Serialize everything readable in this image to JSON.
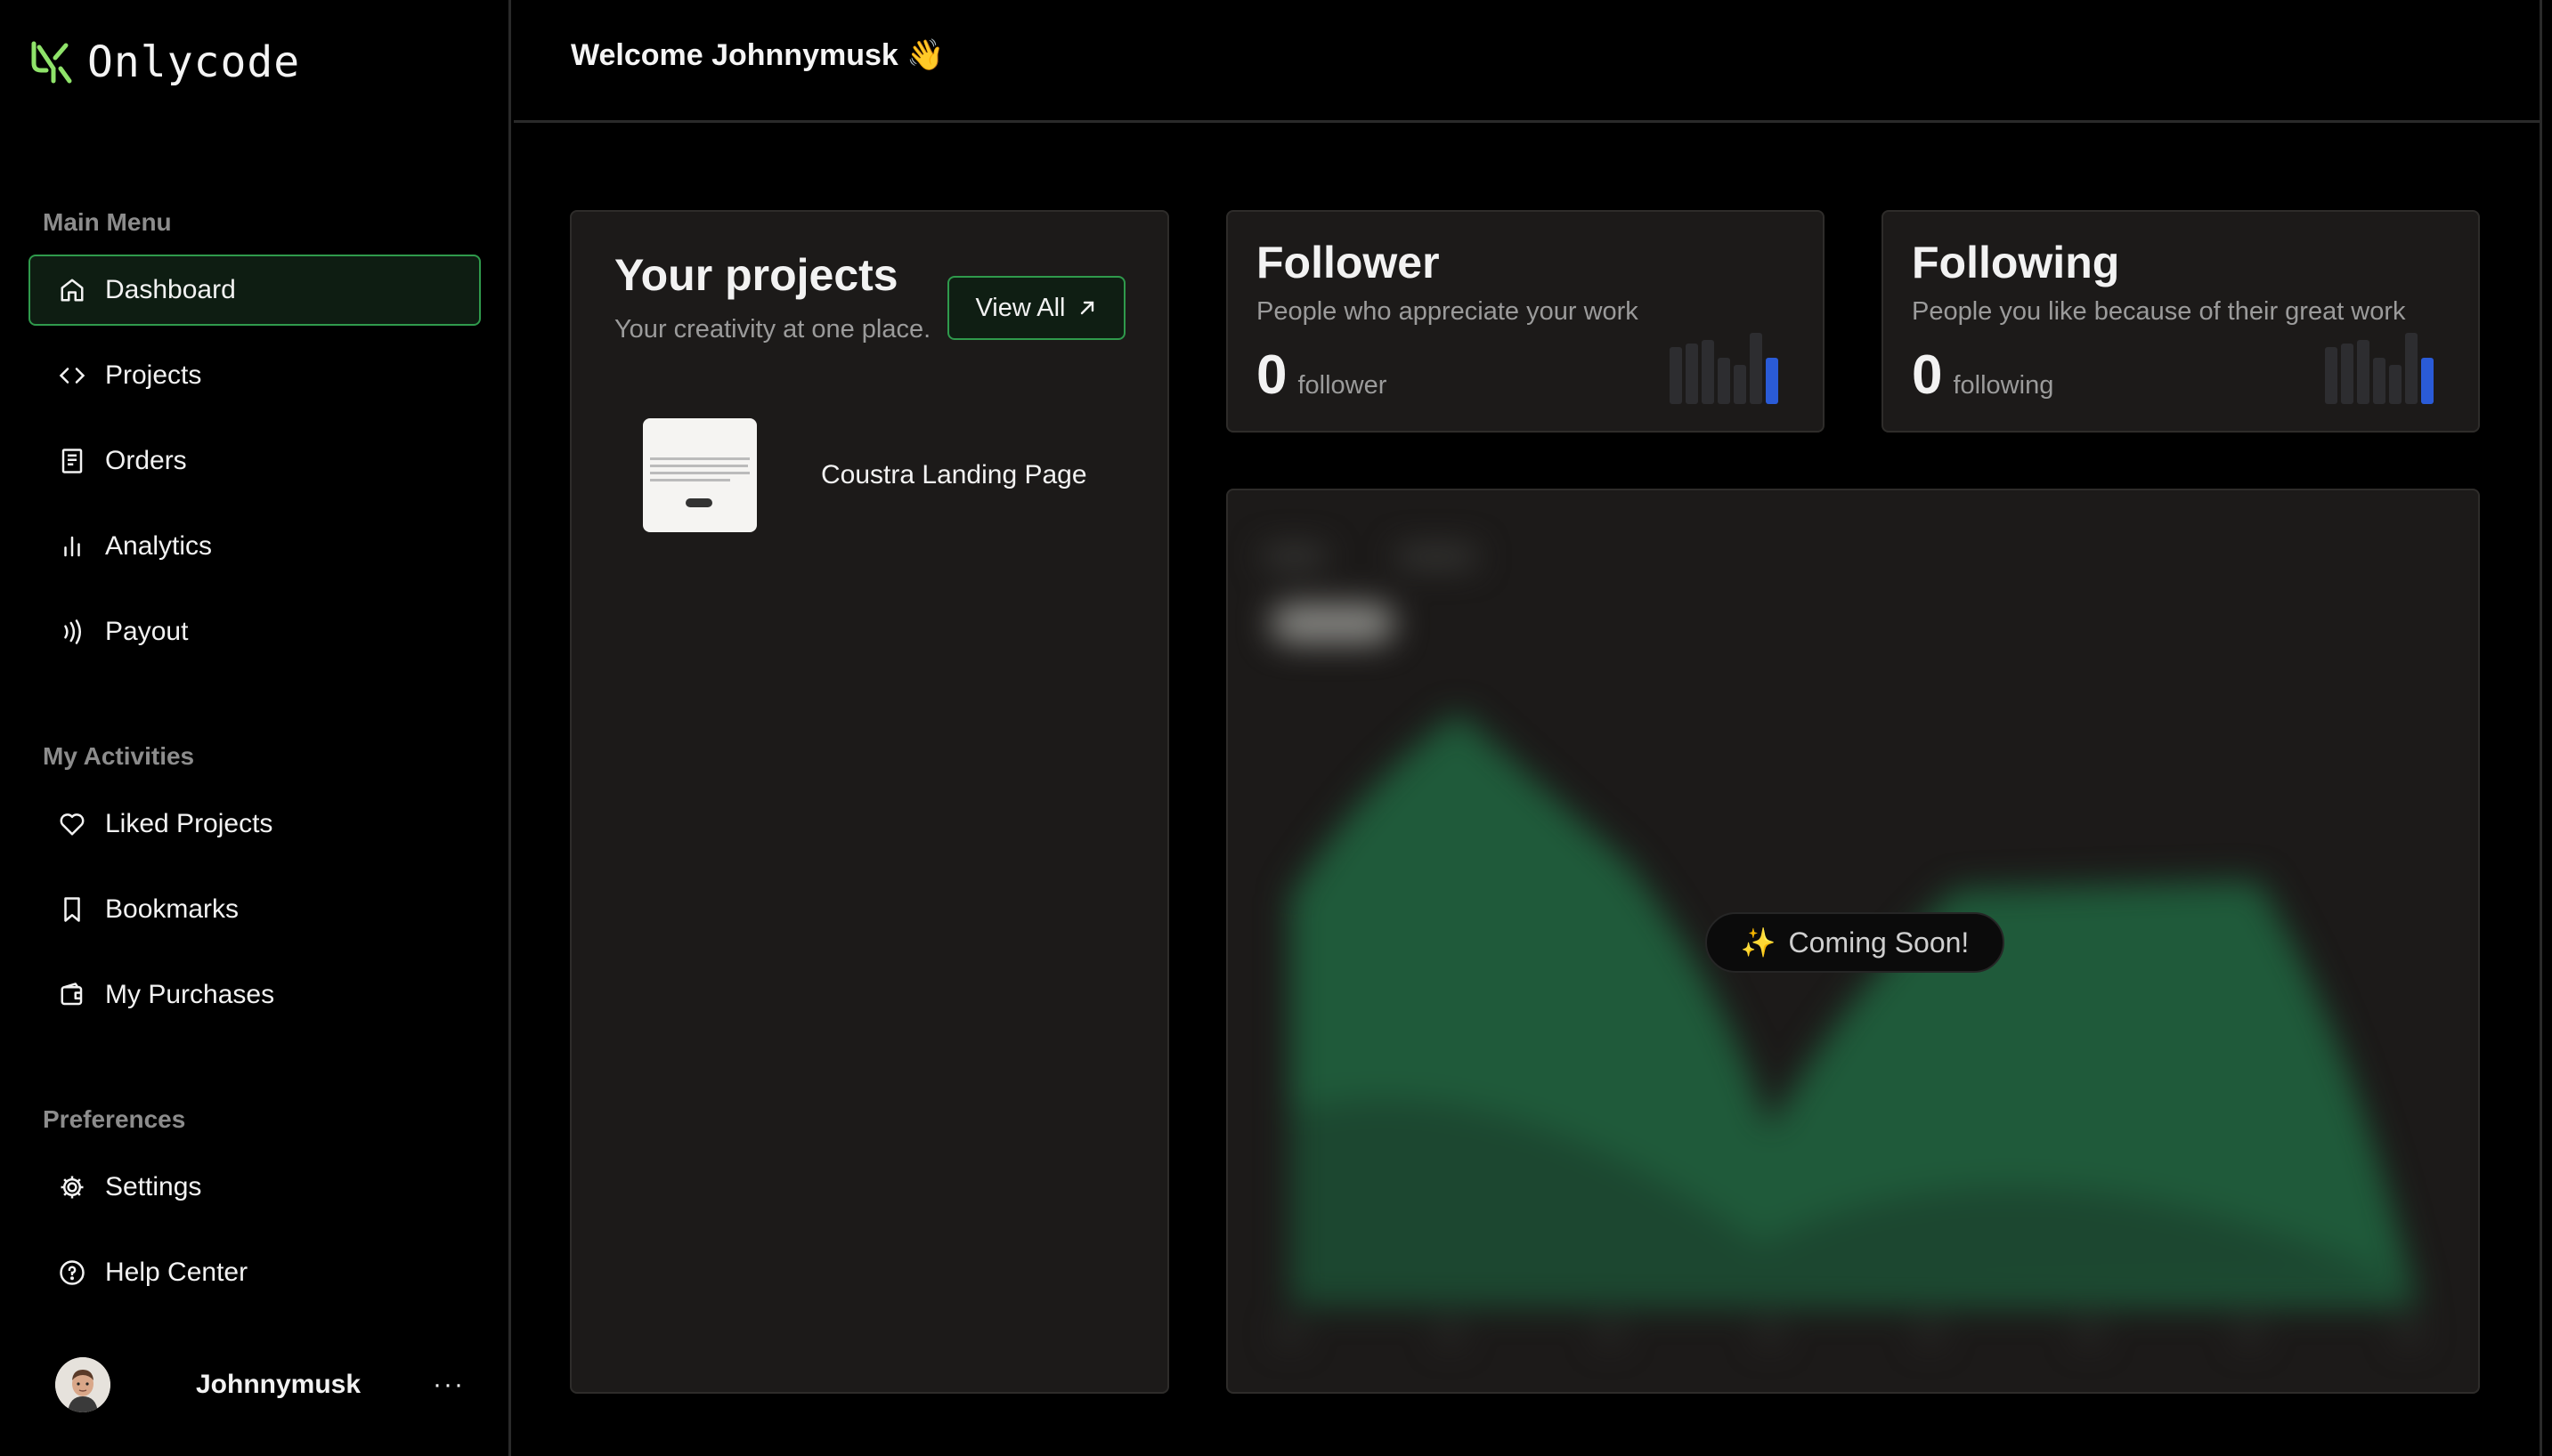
{
  "app": {
    "name": "Onlycode",
    "brand_color": "#8fe36a",
    "accent_color": "#2f9a4c"
  },
  "sidebar": {
    "main_menu_title": "Main Menu",
    "main_menu": [
      {
        "label": "Dashboard",
        "icon": "home-icon",
        "active": true
      },
      {
        "label": "Projects",
        "icon": "code-icon"
      },
      {
        "label": "Orders",
        "icon": "receipt-icon"
      },
      {
        "label": "Analytics",
        "icon": "bar-chart-icon"
      },
      {
        "label": "Payout",
        "icon": "wireless-icon"
      }
    ],
    "activities_title": "My Activities",
    "activities": [
      {
        "label": "Liked Projects",
        "icon": "heart-icon"
      },
      {
        "label": "Bookmarks",
        "icon": "bookmark-icon"
      },
      {
        "label": "My Purchases",
        "icon": "wallet-icon"
      }
    ],
    "preferences_title": "Preferences",
    "preferences": [
      {
        "label": "Settings",
        "icon": "gear-icon"
      },
      {
        "label": "Help Center",
        "icon": "help-circle-icon"
      }
    ],
    "profile": {
      "username": "Johnnymusk",
      "more": "···"
    }
  },
  "header": {
    "welcome": "Welcome Johnnymusk 👋"
  },
  "projects_card": {
    "title": "Your projects",
    "subtitle": "Your creativity at one place.",
    "view_all": "View All",
    "items": [
      {
        "name": "Coustra Landing Page"
      }
    ]
  },
  "follower_card": {
    "title": "Follower",
    "description": "People who appreciate your work",
    "count": "0",
    "unit": "follower"
  },
  "following_card": {
    "title": "Following",
    "description": "People you like because of their great work",
    "count": "0",
    "unit": "following"
  },
  "graph_card": {
    "overlay": "Coming Soon!",
    "overlay_icon": "sparkles-icon"
  }
}
